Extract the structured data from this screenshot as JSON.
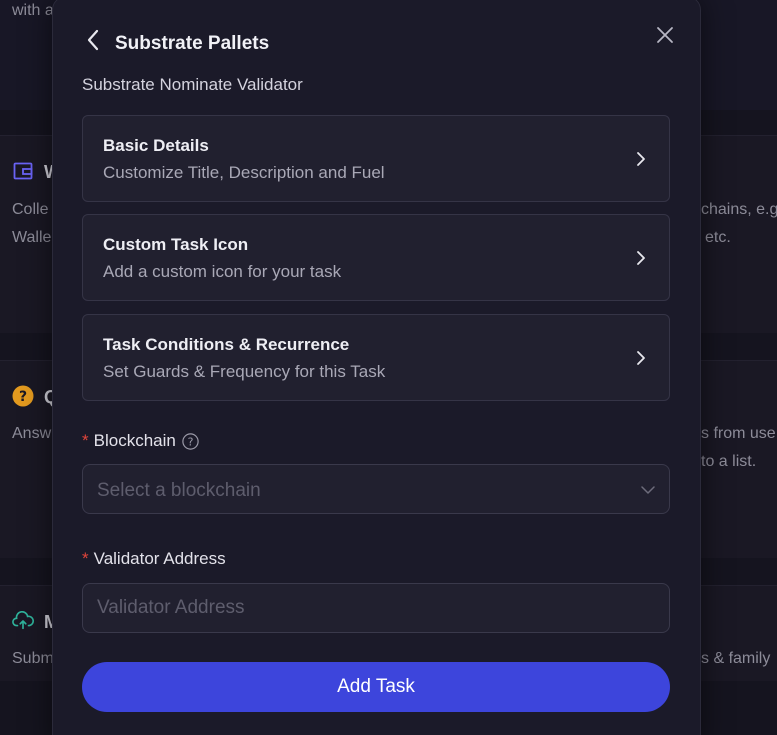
{
  "background": {
    "top_text": "with a",
    "cards": [
      {
        "icon": "wallet-icon",
        "title": "W",
        "left_lines": [
          "Colle",
          "Walle"
        ],
        "right_lines": [
          "chains, e.g",
          "etc."
        ],
        "accent": "#6a63f5"
      },
      {
        "icon": "question-circle-icon",
        "title": "Q",
        "left_lines": [
          "Answ"
        ],
        "right_lines": [
          "s from use",
          "to a list."
        ],
        "accent": "#e39a1f"
      },
      {
        "icon": "cloud-upload-icon",
        "title": "M",
        "left_lines": [
          "Subm"
        ],
        "right_lines": [
          "s & family"
        ],
        "accent": "#2fb39b"
      }
    ]
  },
  "modal": {
    "title": "Substrate Pallets",
    "subtitle": "Substrate Nominate Validator",
    "sections": [
      {
        "title": "Basic Details",
        "description": "Customize Title, Description and Fuel"
      },
      {
        "title": "Custom Task Icon",
        "description": "Add a custom icon for your task"
      },
      {
        "title": "Task Conditions & Recurrence",
        "description": "Set Guards & Frequency for this Task"
      }
    ],
    "blockchain": {
      "required_mark": "*",
      "label": "Blockchain",
      "placeholder": "Select a blockchain"
    },
    "validator": {
      "required_mark": "*",
      "label": "Validator Address",
      "placeholder": "Validator Address",
      "value": ""
    },
    "submit_label": "Add Task"
  }
}
